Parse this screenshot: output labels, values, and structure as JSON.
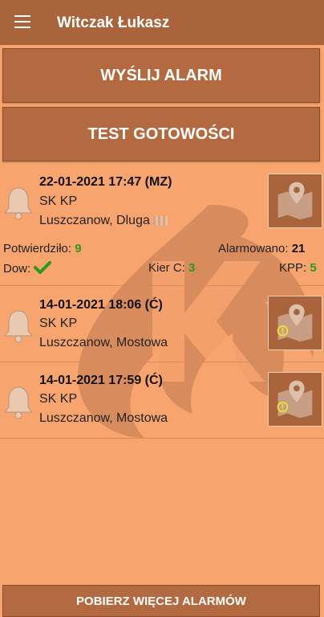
{
  "appbar": {
    "title": "Witczak Łukasz"
  },
  "buttons": {
    "send_alarm": "WYŚLIJ ALARM",
    "readiness_test": "TEST GOTOWOŚCI",
    "load_more": "POBIERZ WIĘCEJ ALARMÓW"
  },
  "alarms": [
    {
      "datetime": "22-01-2021 17:47 (MZ)",
      "unit": "SK KP",
      "address": "Luszczanow, Dluga",
      "stats": {
        "confirmed_label": "Potwierdziło:",
        "confirmed": "9",
        "alarmed_label": "Alarmowano:",
        "alarmed": "21",
        "dow_label": "Dow:",
        "kier_label": "Kier C:",
        "kier": "3",
        "kpp_label": "KPP:",
        "kpp": "5"
      }
    },
    {
      "datetime": "14-01-2021 18:06 (Ć)",
      "unit": "SK KP",
      "address": "Luszczanow, Mostowa"
    },
    {
      "datetime": "14-01-2021 17:59 (Ć)",
      "unit": "SK KP",
      "address": "Luszczanow, Mostowa"
    }
  ],
  "colors": {
    "background": "#f8a46f",
    "appbar": "#a9643c",
    "button": "#b36a41",
    "accent_green": "#2a9a1d",
    "warning_yellow": "#e8e03a"
  }
}
